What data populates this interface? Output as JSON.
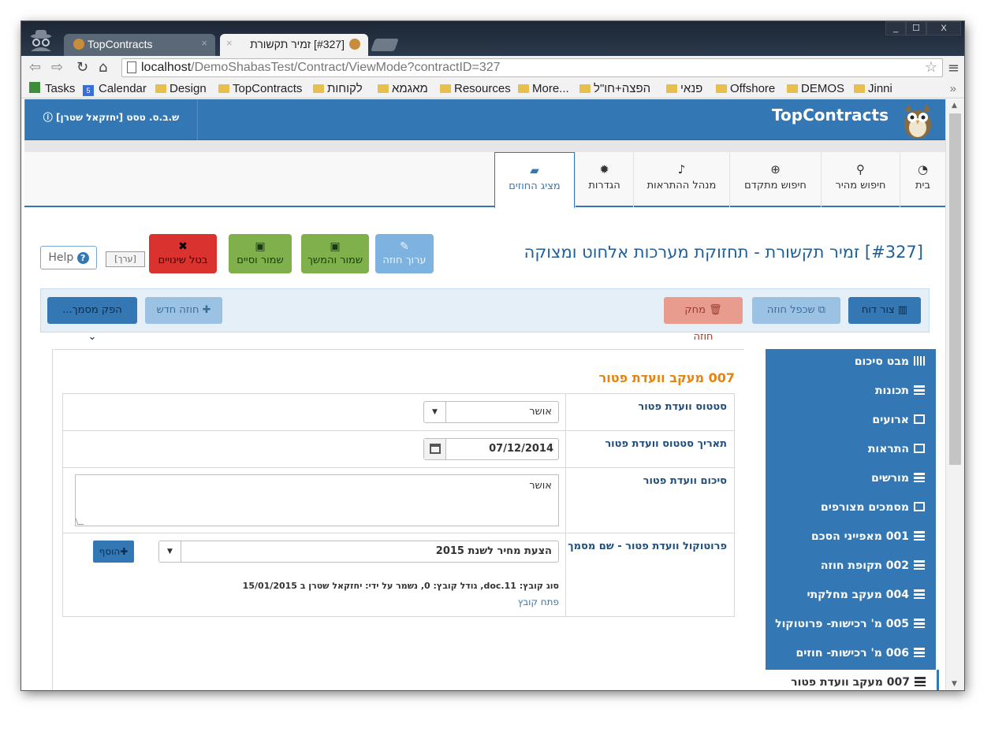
{
  "browser": {
    "tabs": [
      {
        "title": "TopContracts"
      },
      {
        "title": "[#327] זמיר תקשורת"
      }
    ],
    "window_buttons": {
      "minimize": "_",
      "maximize": "☐",
      "close": "X"
    },
    "url_host": "localhost",
    "url_path": "/DemoShabasTest/Contract/ViewMode?contractID=327",
    "bookmarks": [
      "Tasks",
      "Calendar",
      "Design",
      "TopContracts",
      "לקוחות",
      "מאגמא",
      "Resources",
      "More...",
      "הפצה+חו\"ל",
      "פנאי",
      "Offshore",
      "DEMOS",
      "Jinni"
    ],
    "calendar_badge": "5",
    "bookmarks_overflow": "»"
  },
  "app": {
    "brand": "TopContracts",
    "user_label": "ש.ב.ס. טסט [יחזקאל שטרן]",
    "nav_tabs": [
      "בית",
      "חיפוש מהיר",
      "חיפוש מתקדם",
      "מנהל ההתראות",
      "הגדרות",
      "מציג החוזים"
    ],
    "nav_icons": [
      "dashboard-icon",
      "search-icon",
      "zoom-plus-icon",
      "bell-icon",
      "gear-icon",
      "book-icon"
    ],
    "accent_color": "#3378b5"
  },
  "contract": {
    "title": "[#327] זמיר תקשורת - תחזוקת מערכות אלחוט ומצוקה",
    "buttons": {
      "edit": "ערוך חוזה",
      "save_continue": "שמור והמשך",
      "save_close": "שמור וסיים",
      "cancel": "בטל שינויים",
      "edit_chip": "[ערך]",
      "help": "Help"
    }
  },
  "toolbar": {
    "report": "צור דוח",
    "clone": "שכפל חוזה",
    "delete": "מחק חוזה",
    "new": "חוזה חדש",
    "produce_doc": "הפק מסמך..."
  },
  "sidemenu": [
    "מבט סיכום",
    "תכונות",
    "ארועים",
    "התראות",
    "מורשים",
    "מסמכים מצורפים",
    "001 מאפייני הסכם",
    "002 תקופת חוזה",
    "004 מעקב מחלקתי",
    "005 מ' רכישות- פרוטוקול",
    "006 מ' רכישות- חוזים",
    "007 מעקב וועדת פטור"
  ],
  "section": {
    "title": "007 מעקב וועדת פטור",
    "fields": {
      "status_label": "סטטוס וועדת פטור",
      "status_value": "אושר",
      "date_label": "תאריך סטטוס וועדת פטור",
      "date_value": "07/12/2014",
      "summary_label": "סיכום וועדת פטור",
      "summary_value": "אושר",
      "protocol_label": "פרוטוקול וועדת פטור - שם מסמך",
      "protocol_value": "הצעת מחיר לשנת 2015",
      "add_button": "הוסף",
      "file_info": "סוג קובץ: doc.11, גודל קובץ: 0, נשמר על ידי: יחזקאל שטרן ב 15/01/2015",
      "open_file": "פתח קובץ"
    }
  }
}
